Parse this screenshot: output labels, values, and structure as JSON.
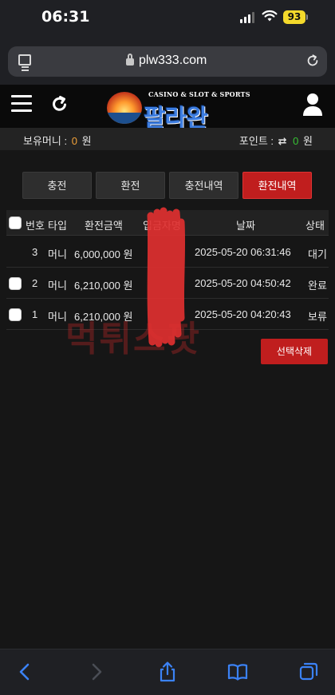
{
  "status_bar": {
    "time": "06:31",
    "battery": "93"
  },
  "browser": {
    "url": "plw333.com"
  },
  "header": {
    "logo_small": "CASINO & SLOT & SPORTS",
    "logo_name": "팔라완"
  },
  "info_bar": {
    "balance_label": "보유머니 :",
    "balance_value": "0",
    "balance_unit": "원",
    "point_label": "포인트 :",
    "point_swap": "⇄",
    "point_value": "0",
    "point_unit": "원"
  },
  "tabs": [
    {
      "label": "충전",
      "active": false
    },
    {
      "label": "환전",
      "active": false
    },
    {
      "label": "충전내역",
      "active": false
    },
    {
      "label": "환전내역",
      "active": true
    }
  ],
  "table": {
    "headers": {
      "no": "번호",
      "type": "타입",
      "amount": "환전금액",
      "name": "입금자명",
      "date": "날짜",
      "status": "상태"
    },
    "rows": [
      {
        "no": "3",
        "type": "머니",
        "amount": "6,000,000 원",
        "date": "2025-05-20 06:31:46",
        "status": "대기",
        "has_checkbox": false
      },
      {
        "no": "2",
        "type": "머니",
        "amount": "6,210,000 원",
        "date": "2025-05-20 04:50:42",
        "status": "완료",
        "has_checkbox": true
      },
      {
        "no": "1",
        "type": "머니",
        "amount": "6,210,000 원",
        "date": "2025-05-20 04:20:43",
        "status": "보류",
        "has_checkbox": true
      }
    ]
  },
  "actions": {
    "delete_selected": "선택삭제"
  },
  "watermark": "먹튀스팟",
  "colors": {
    "accent_red": "#c01e1e",
    "balance_orange": "#f2a23a",
    "point_green": "#37c234"
  }
}
